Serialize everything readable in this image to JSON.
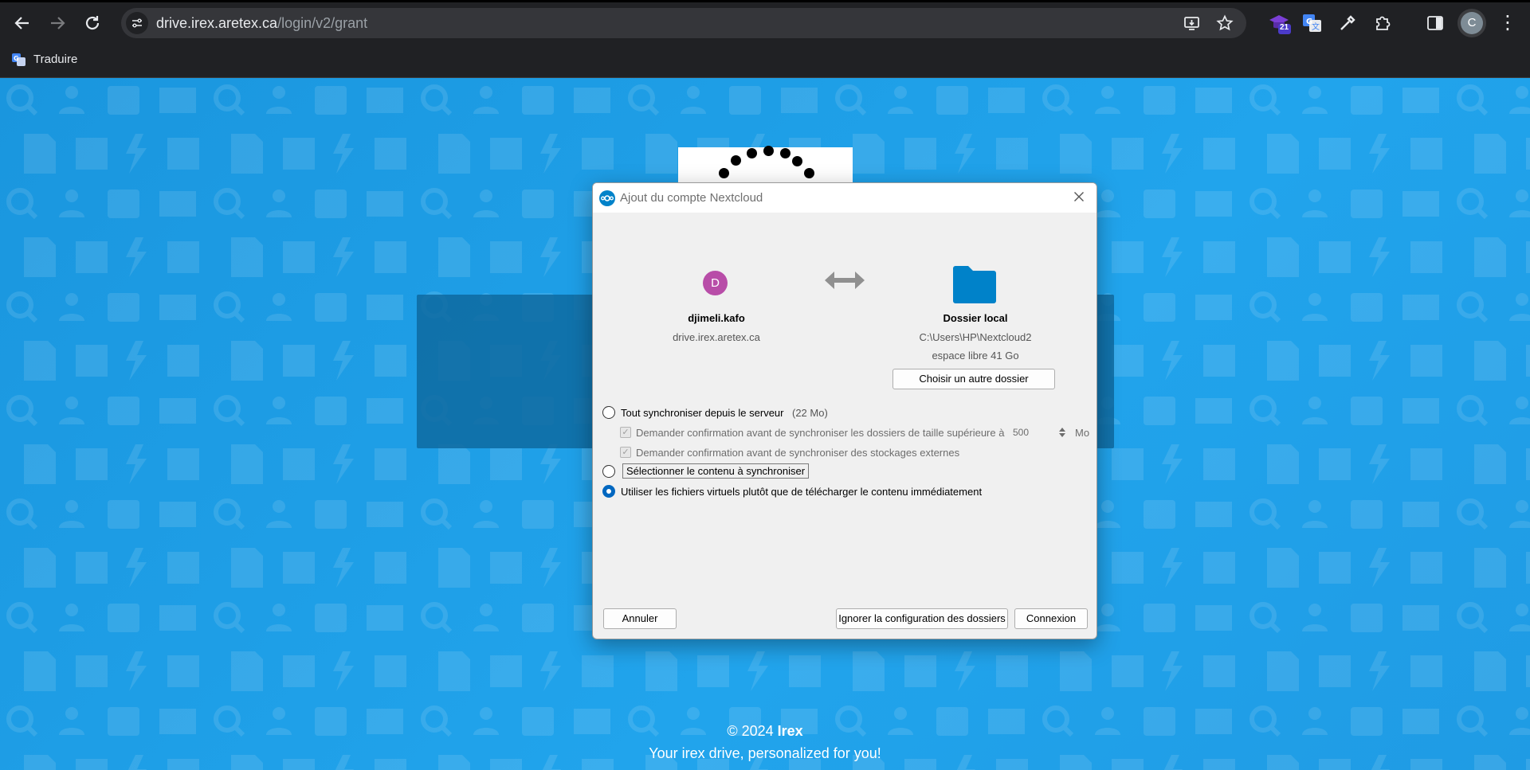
{
  "browser": {
    "url_host": "drive.irex.aretex.ca",
    "url_path": "/login/v2/grant",
    "extension_badge": "21",
    "profile_initial": "C",
    "bookmark_label": "Traduire",
    "icons": [
      "back-arrow-icon",
      "forward-arrow-icon",
      "reload-icon",
      "site-settings-icon",
      "install-app-icon",
      "star-icon",
      "extension-icon",
      "translate-icon",
      "eyedropper-icon",
      "puzzle-icon",
      "side-panel-icon",
      "more-vert-icon"
    ]
  },
  "page": {
    "footer_copy_prefix": "© 2024 ",
    "footer_brand": "Irex",
    "footer_slogan": "Your irex drive, personalized for you!"
  },
  "dialog": {
    "title": "Ajout du compte Nextcloud",
    "account": {
      "initial": "D",
      "name": "djimeli.kafo",
      "server": "drive.irex.aretex.ca"
    },
    "local": {
      "title": "Dossier local",
      "path": "C:\\Users\\HP\\Nextcloud2",
      "free_space": "espace libre 41 Go",
      "choose_button": "Choisir un autre dossier"
    },
    "options": {
      "sync_all": "Tout synchroniser depuis le serveur",
      "sync_all_size": "(22 Mo)",
      "confirm_large": "Demander confirmation avant de synchroniser les dossiers de taille supérieure à",
      "confirm_large_value": "500",
      "confirm_large_unit": "Mo",
      "confirm_external": "Demander confirmation avant de synchroniser des stockages externes",
      "select_content": "Sélectionner le contenu à synchroniser",
      "virtual_files": "Utiliser les fichiers virtuels plutôt que de télécharger le contenu immédiatement",
      "selected": "virtual_files"
    },
    "buttons": {
      "cancel": "Annuler",
      "ignore": "Ignorer la configuration des dossiers",
      "connect": "Connexion"
    }
  },
  "colors": {
    "page_bg": "#1d9ee6",
    "chrome_bg": "#202124",
    "accent": "#0067c0",
    "avatar": "#b84da8",
    "folder": "#0082c9"
  }
}
